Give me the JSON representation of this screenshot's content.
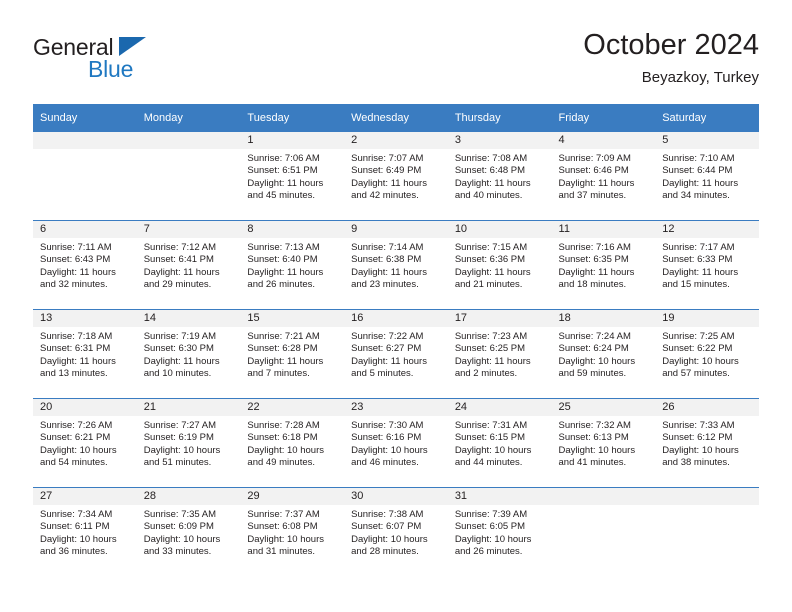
{
  "brand": {
    "name_part1": "General",
    "name_part2": "Blue",
    "triangle_color": "#1b68ae",
    "blue_color": "#1f78c1"
  },
  "header": {
    "title": "October 2024",
    "subtitle": "Beyazkoy, Turkey"
  },
  "theme": {
    "header_blue": "#3a7cc1",
    "date_band_gray": "#f2f2f2",
    "text_color": "#231f20"
  },
  "weekdays": [
    "Sunday",
    "Monday",
    "Tuesday",
    "Wednesday",
    "Thursday",
    "Friday",
    "Saturday"
  ],
  "weeks": [
    [
      {
        "date": "",
        "blank": true
      },
      {
        "date": "",
        "blank": true
      },
      {
        "date": "1",
        "sunrise": "Sunrise: 7:06 AM",
        "sunset": "Sunset: 6:51 PM",
        "daylight_line1": "Daylight: 11 hours",
        "daylight_line2": "and 45 minutes."
      },
      {
        "date": "2",
        "sunrise": "Sunrise: 7:07 AM",
        "sunset": "Sunset: 6:49 PM",
        "daylight_line1": "Daylight: 11 hours",
        "daylight_line2": "and 42 minutes."
      },
      {
        "date": "3",
        "sunrise": "Sunrise: 7:08 AM",
        "sunset": "Sunset: 6:48 PM",
        "daylight_line1": "Daylight: 11 hours",
        "daylight_line2": "and 40 minutes."
      },
      {
        "date": "4",
        "sunrise": "Sunrise: 7:09 AM",
        "sunset": "Sunset: 6:46 PM",
        "daylight_line1": "Daylight: 11 hours",
        "daylight_line2": "and 37 minutes."
      },
      {
        "date": "5",
        "sunrise": "Sunrise: 7:10 AM",
        "sunset": "Sunset: 6:44 PM",
        "daylight_line1": "Daylight: 11 hours",
        "daylight_line2": "and 34 minutes."
      }
    ],
    [
      {
        "date": "6",
        "sunrise": "Sunrise: 7:11 AM",
        "sunset": "Sunset: 6:43 PM",
        "daylight_line1": "Daylight: 11 hours",
        "daylight_line2": "and 32 minutes."
      },
      {
        "date": "7",
        "sunrise": "Sunrise: 7:12 AM",
        "sunset": "Sunset: 6:41 PM",
        "daylight_line1": "Daylight: 11 hours",
        "daylight_line2": "and 29 minutes."
      },
      {
        "date": "8",
        "sunrise": "Sunrise: 7:13 AM",
        "sunset": "Sunset: 6:40 PM",
        "daylight_line1": "Daylight: 11 hours",
        "daylight_line2": "and 26 minutes."
      },
      {
        "date": "9",
        "sunrise": "Sunrise: 7:14 AM",
        "sunset": "Sunset: 6:38 PM",
        "daylight_line1": "Daylight: 11 hours",
        "daylight_line2": "and 23 minutes."
      },
      {
        "date": "10",
        "sunrise": "Sunrise: 7:15 AM",
        "sunset": "Sunset: 6:36 PM",
        "daylight_line1": "Daylight: 11 hours",
        "daylight_line2": "and 21 minutes."
      },
      {
        "date": "11",
        "sunrise": "Sunrise: 7:16 AM",
        "sunset": "Sunset: 6:35 PM",
        "daylight_line1": "Daylight: 11 hours",
        "daylight_line2": "and 18 minutes."
      },
      {
        "date": "12",
        "sunrise": "Sunrise: 7:17 AM",
        "sunset": "Sunset: 6:33 PM",
        "daylight_line1": "Daylight: 11 hours",
        "daylight_line2": "and 15 minutes."
      }
    ],
    [
      {
        "date": "13",
        "sunrise": "Sunrise: 7:18 AM",
        "sunset": "Sunset: 6:31 PM",
        "daylight_line1": "Daylight: 11 hours",
        "daylight_line2": "and 13 minutes."
      },
      {
        "date": "14",
        "sunrise": "Sunrise: 7:19 AM",
        "sunset": "Sunset: 6:30 PM",
        "daylight_line1": "Daylight: 11 hours",
        "daylight_line2": "and 10 minutes."
      },
      {
        "date": "15",
        "sunrise": "Sunrise: 7:21 AM",
        "sunset": "Sunset: 6:28 PM",
        "daylight_line1": "Daylight: 11 hours",
        "daylight_line2": "and 7 minutes."
      },
      {
        "date": "16",
        "sunrise": "Sunrise: 7:22 AM",
        "sunset": "Sunset: 6:27 PM",
        "daylight_line1": "Daylight: 11 hours",
        "daylight_line2": "and 5 minutes."
      },
      {
        "date": "17",
        "sunrise": "Sunrise: 7:23 AM",
        "sunset": "Sunset: 6:25 PM",
        "daylight_line1": "Daylight: 11 hours",
        "daylight_line2": "and 2 minutes."
      },
      {
        "date": "18",
        "sunrise": "Sunrise: 7:24 AM",
        "sunset": "Sunset: 6:24 PM",
        "daylight_line1": "Daylight: 10 hours",
        "daylight_line2": "and 59 minutes."
      },
      {
        "date": "19",
        "sunrise": "Sunrise: 7:25 AM",
        "sunset": "Sunset: 6:22 PM",
        "daylight_line1": "Daylight: 10 hours",
        "daylight_line2": "and 57 minutes."
      }
    ],
    [
      {
        "date": "20",
        "sunrise": "Sunrise: 7:26 AM",
        "sunset": "Sunset: 6:21 PM",
        "daylight_line1": "Daylight: 10 hours",
        "daylight_line2": "and 54 minutes."
      },
      {
        "date": "21",
        "sunrise": "Sunrise: 7:27 AM",
        "sunset": "Sunset: 6:19 PM",
        "daylight_line1": "Daylight: 10 hours",
        "daylight_line2": "and 51 minutes."
      },
      {
        "date": "22",
        "sunrise": "Sunrise: 7:28 AM",
        "sunset": "Sunset: 6:18 PM",
        "daylight_line1": "Daylight: 10 hours",
        "daylight_line2": "and 49 minutes."
      },
      {
        "date": "23",
        "sunrise": "Sunrise: 7:30 AM",
        "sunset": "Sunset: 6:16 PM",
        "daylight_line1": "Daylight: 10 hours",
        "daylight_line2": "and 46 minutes."
      },
      {
        "date": "24",
        "sunrise": "Sunrise: 7:31 AM",
        "sunset": "Sunset: 6:15 PM",
        "daylight_line1": "Daylight: 10 hours",
        "daylight_line2": "and 44 minutes."
      },
      {
        "date": "25",
        "sunrise": "Sunrise: 7:32 AM",
        "sunset": "Sunset: 6:13 PM",
        "daylight_line1": "Daylight: 10 hours",
        "daylight_line2": "and 41 minutes."
      },
      {
        "date": "26",
        "sunrise": "Sunrise: 7:33 AM",
        "sunset": "Sunset: 6:12 PM",
        "daylight_line1": "Daylight: 10 hours",
        "daylight_line2": "and 38 minutes."
      }
    ],
    [
      {
        "date": "27",
        "sunrise": "Sunrise: 7:34 AM",
        "sunset": "Sunset: 6:11 PM",
        "daylight_line1": "Daylight: 10 hours",
        "daylight_line2": "and 36 minutes."
      },
      {
        "date": "28",
        "sunrise": "Sunrise: 7:35 AM",
        "sunset": "Sunset: 6:09 PM",
        "daylight_line1": "Daylight: 10 hours",
        "daylight_line2": "and 33 minutes."
      },
      {
        "date": "29",
        "sunrise": "Sunrise: 7:37 AM",
        "sunset": "Sunset: 6:08 PM",
        "daylight_line1": "Daylight: 10 hours",
        "daylight_line2": "and 31 minutes."
      },
      {
        "date": "30",
        "sunrise": "Sunrise: 7:38 AM",
        "sunset": "Sunset: 6:07 PM",
        "daylight_line1": "Daylight: 10 hours",
        "daylight_line2": "and 28 minutes."
      },
      {
        "date": "31",
        "sunrise": "Sunrise: 7:39 AM",
        "sunset": "Sunset: 6:05 PM",
        "daylight_line1": "Daylight: 10 hours",
        "daylight_line2": "and 26 minutes."
      },
      {
        "date": "",
        "blank": true
      },
      {
        "date": "",
        "blank": true
      }
    ]
  ]
}
